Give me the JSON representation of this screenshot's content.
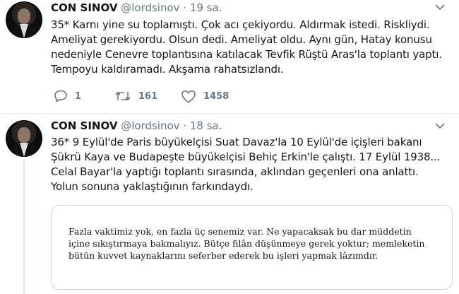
{
  "tweets": [
    {
      "name": "CON SINOV",
      "handle": "@lordsinov",
      "separator": "·",
      "time": "19 sa.",
      "text": "35* Karnı yine su toplamıştı. Çok acı çekiyordu. Aldırmak istedi. Riskliydi. Ameliyat gerekiyordu. Olsun dedi. Ameliyat oldu. Aynı gün, Hatay konusu nedeniyle Cenevre toplantısına katılacak Tevfik Rüştü Aras'la toplantı yaptı. Tempoyu kaldıramadı. Akşama rahatsızlandı.",
      "replies": "1",
      "retweets": "161",
      "likes": "1458"
    },
    {
      "name": "CON SINOV",
      "handle": "@lordsinov",
      "separator": "·",
      "time": "18 sa.",
      "text": "36* 9 Eylül'de Paris büyükelçisi Suat Davaz'la 10 Eylül'de içişleri bakanı Şükrü Kaya ve Budapeşte büyükelçisi Behiç Erkin'le çalıştı. 17 Eylül 1938... Celal Bayar'la yaptığı toplantı sırasında, aklından geçenleri ona anlattı. Yolun sonuna yaklaştığının farkındaydı.",
      "quote": "Fazla vaktimiz yok, en fazla üç senemiz var. Ne yapacaksak bu dar müddetin içine sıkıştırmaya bakmalıyız. Bütçe filân düşünmeye gerek yoktur; memleketin bütün kuvvet kaynaklarını seferber ederek bu işleri yapmak lâzımdır."
    }
  ],
  "colors": {
    "text": "#14171a",
    "muted": "#657786",
    "border": "#ccd6dd",
    "line": "#e1e8ed"
  },
  "icons": [
    "reply-icon",
    "retweet-icon",
    "like-icon",
    "chevron-down-icon"
  ]
}
